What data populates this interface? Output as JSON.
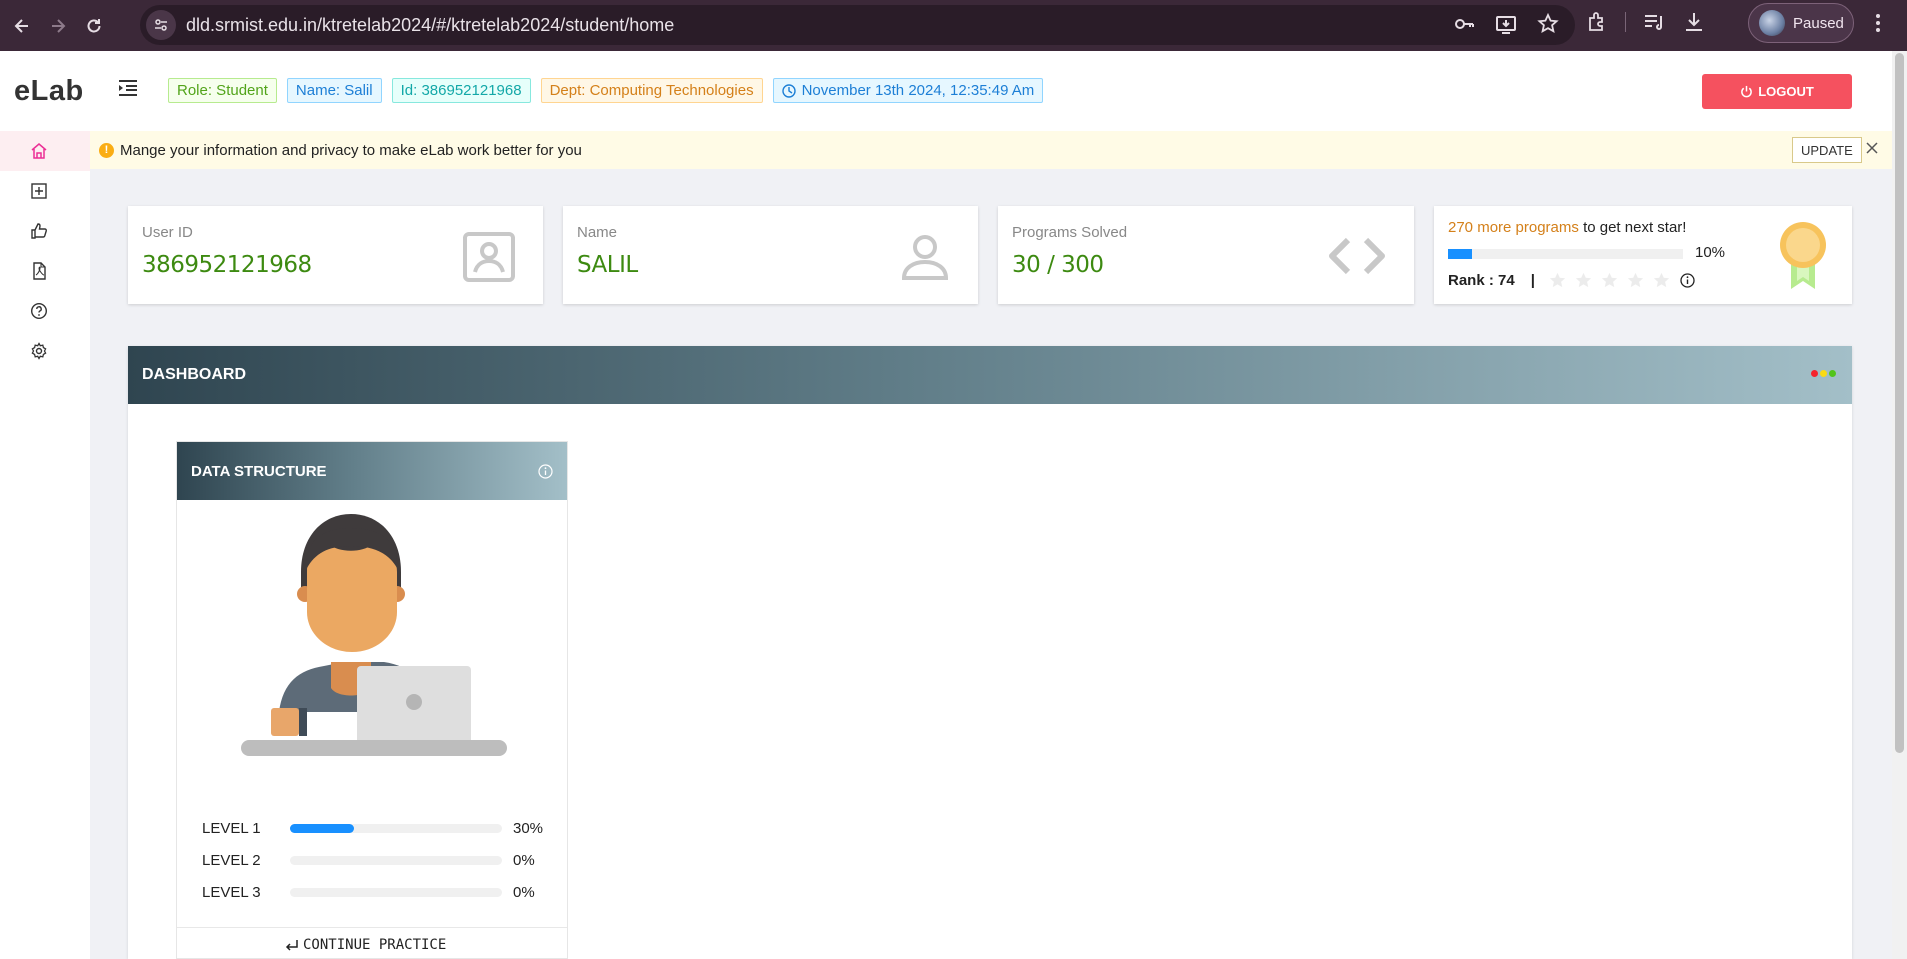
{
  "browser": {
    "url": "dld.srmist.edu.in/ktretelab2024/#/ktretelab2024/student/home",
    "profile_label": "Paused"
  },
  "app": {
    "logo": "eLab",
    "chips": {
      "role": "Role: Student",
      "name": "Name: Salil",
      "id": "Id: 386952121968",
      "dept": "Dept: Computing Technologies",
      "datetime": "November 13th 2024, 12:35:49 Am"
    },
    "logout_label": "LOGOUT"
  },
  "sidebar": {
    "items": [
      {
        "icon": "home-icon",
        "active": true
      },
      {
        "icon": "plus-square-icon"
      },
      {
        "icon": "thumbs-up-icon"
      },
      {
        "icon": "pdf-file-icon"
      },
      {
        "icon": "help-circle-icon"
      },
      {
        "icon": "gear-icon"
      }
    ]
  },
  "alert": {
    "message": "Mange your information and privacy to make eLab work better for you",
    "update_label": "UPDATE"
  },
  "cards": {
    "user_id": {
      "label": "User ID",
      "value": "386952121968"
    },
    "name": {
      "label": "Name",
      "value": "SALIL"
    },
    "programs": {
      "label": "Programs Solved",
      "value": "30 / 300"
    },
    "star": {
      "highlight": "270 more programs",
      "rest": " to get next star!",
      "progress_pct": 10,
      "progress_text": "10%",
      "rank": "Rank : 74",
      "stars_filled": 0,
      "stars_total": 5
    }
  },
  "dashboard": {
    "title": "DASHBOARD",
    "dot_colors": [
      "#f5222d",
      "#fadb14",
      "#52c41a"
    ],
    "course": {
      "title": "DATA STRUCTURE",
      "levels": [
        {
          "name": "LEVEL 1",
          "pct": 30,
          "text": "30%"
        },
        {
          "name": "LEVEL 2",
          "pct": 0,
          "text": "0%"
        },
        {
          "name": "LEVEL 3",
          "pct": 0,
          "text": "0%"
        }
      ],
      "continue_label": "CONTINUE PRACTICE"
    }
  },
  "colors": {
    "accent_green": "#3d8a11",
    "logout_red": "#f5515f",
    "progress_blue": "#1890ff"
  }
}
